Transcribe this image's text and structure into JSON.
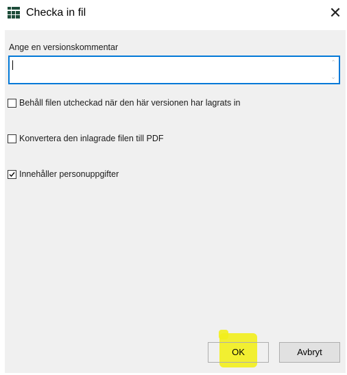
{
  "window": {
    "title": "Checka in fil",
    "close_glyph": "✕",
    "icon": "grid-app-icon"
  },
  "comment": {
    "label": "Ange en versionskommentar",
    "value": ""
  },
  "options": [
    {
      "label": "Behåll filen utcheckad när den här versionen har lagrats in",
      "checked": false
    },
    {
      "label": "Konvertera den inlagrade filen till PDF",
      "checked": false
    },
    {
      "label": "Innehåller personuppgifter",
      "checked": true
    }
  ],
  "buttons": {
    "ok_label": "OK",
    "cancel_label": "Avbryt"
  },
  "colors": {
    "focus_border": "#0078d7",
    "highlight": "#f2ee1c",
    "app_icon": "#1e4d3a"
  }
}
